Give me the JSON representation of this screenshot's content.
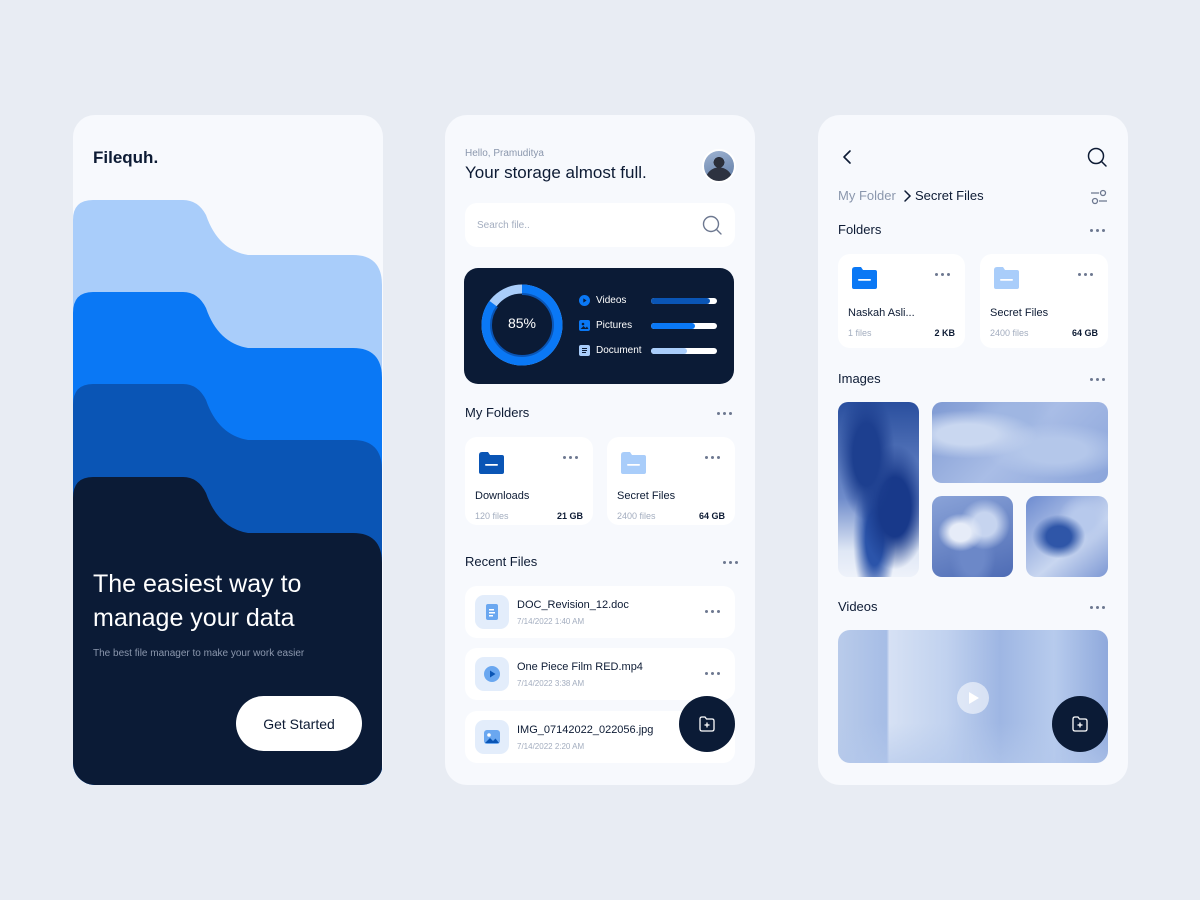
{
  "onboarding": {
    "brand": "Filequh.",
    "title": "The easiest way to manage your data",
    "subtitle": "The best file manager to make your work easier",
    "cta": "Get Started"
  },
  "home": {
    "greeting": "Hello, Pramuditya",
    "headline": "Your storage almost full.",
    "search_placeholder": "Search file..",
    "storage": {
      "percent_label": "85%",
      "percent": 85,
      "items": [
        {
          "label": "Videos",
          "fill": 0.9,
          "icon": "video-icon"
        },
        {
          "label": "Pictures",
          "fill": 0.67,
          "icon": "picture-icon"
        },
        {
          "label": "Document",
          "fill": 0.55,
          "icon": "document-icon"
        }
      ]
    },
    "my_folders_title": "My Folders",
    "folders": [
      {
        "name": "Downloads",
        "count": "120 files",
        "size": "21 GB"
      },
      {
        "name": "Secret Files",
        "count": "2400 files",
        "size": "64 GB"
      }
    ],
    "recent_title": "Recent Files",
    "recent_files": [
      {
        "name": "DOC_Revision_12.doc",
        "date": "7/14/2022 1:40 AM",
        "icon": "doc-icon"
      },
      {
        "name": "One Piece Film RED.mp4",
        "date": "7/14/2022 3:38 AM",
        "icon": "play-icon"
      },
      {
        "name": "IMG_07142022_022056.jpg",
        "date": "7/14/2022 2:20 AM",
        "icon": "image-icon"
      }
    ]
  },
  "folder_view": {
    "breadcrumb_root": "My Folder",
    "breadcrumb_current": "Secret Files",
    "folders_title": "Folders",
    "folders": [
      {
        "name": "Naskah Asli...",
        "count": "1 files",
        "size": "2 KB"
      },
      {
        "name": "Secret Files",
        "count": "2400 files",
        "size": "64 GB"
      }
    ],
    "images_title": "Images",
    "videos_title": "Videos"
  },
  "colors": {
    "navy": "#0b1b36",
    "blue": "#0a78f5",
    "dark_blue": "#0a55b5",
    "light_blue": "#a9cdfa",
    "background": "#e8ecf3"
  }
}
